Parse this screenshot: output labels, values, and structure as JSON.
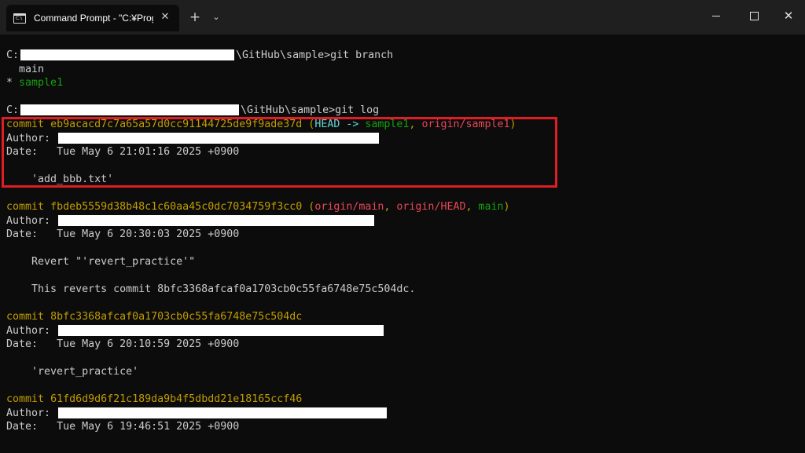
{
  "window": {
    "tab_title": "Command Prompt - \"C:¥Progr",
    "tab_icon": "cmd-icon",
    "new_tab": "+",
    "dropdown": "⌄",
    "close": "✕"
  },
  "terminal": {
    "prompt1": {
      "drive": "C:",
      "path_tail": "\\GitHub\\sample>",
      "command": "git branch"
    },
    "branches": [
      {
        "marker": " ",
        "name": "main"
      },
      {
        "marker": "*",
        "name": "sample1"
      }
    ],
    "prompt2": {
      "drive": "C:",
      "path_tail": "\\GitHub\\sample>",
      "command": "git log"
    },
    "commits": [
      {
        "label": "commit",
        "hash": "eb9acacd7c7a65a57d0cc91144725de9f9ade37d",
        "refs_open": "(",
        "head": "HEAD ->",
        "branch": "sample1",
        "sep": ",",
        "remote": "origin/sample1",
        "refs_close": ")",
        "author_label": "Author:",
        "date_label": "Date:",
        "date": "Tue May 6 21:01:16 2025 +0900",
        "message": "'add_bbb.txt'"
      },
      {
        "label": "commit",
        "hash": "fbdeb5559d38b48c1c60aa45c0dc7034759f3cc0",
        "refs_open": "(",
        "ref1": "origin/main",
        "sep1": ",",
        "ref2": "origin/HEAD",
        "sep2": ",",
        "ref3": "main",
        "refs_close": ")",
        "author_label": "Author:",
        "date_label": "Date:",
        "date": "Tue May 6 20:30:03 2025 +0900",
        "message": "Revert \"'revert_practice'\"",
        "message2": "This reverts commit 8bfc3368afcaf0a1703cb0c55fa6748e75c504dc."
      },
      {
        "label": "commit",
        "hash": "8bfc3368afcaf0a1703cb0c55fa6748e75c504dc",
        "author_label": "Author:",
        "date_label": "Date:",
        "date": "Tue May 6 20:10:59 2025 +0900",
        "message": "'revert_practice'"
      },
      {
        "label": "commit",
        "hash": "61fd6d9d6f21c189da9b4f5dbdd21e18165ccf46",
        "author_label": "Author:",
        "date_label": "Date:",
        "date": "Tue May 6 19:46:51 2025 +0900"
      }
    ]
  },
  "colors": {
    "background": "#0c0c0c",
    "titlebar": "#1f1f1f",
    "commit_yellow": "#c19c00",
    "head_cyan": "#61d6d6",
    "branch_green": "#13a10e",
    "remote_red": "#e74856",
    "highlight_red": "#e01d24"
  }
}
